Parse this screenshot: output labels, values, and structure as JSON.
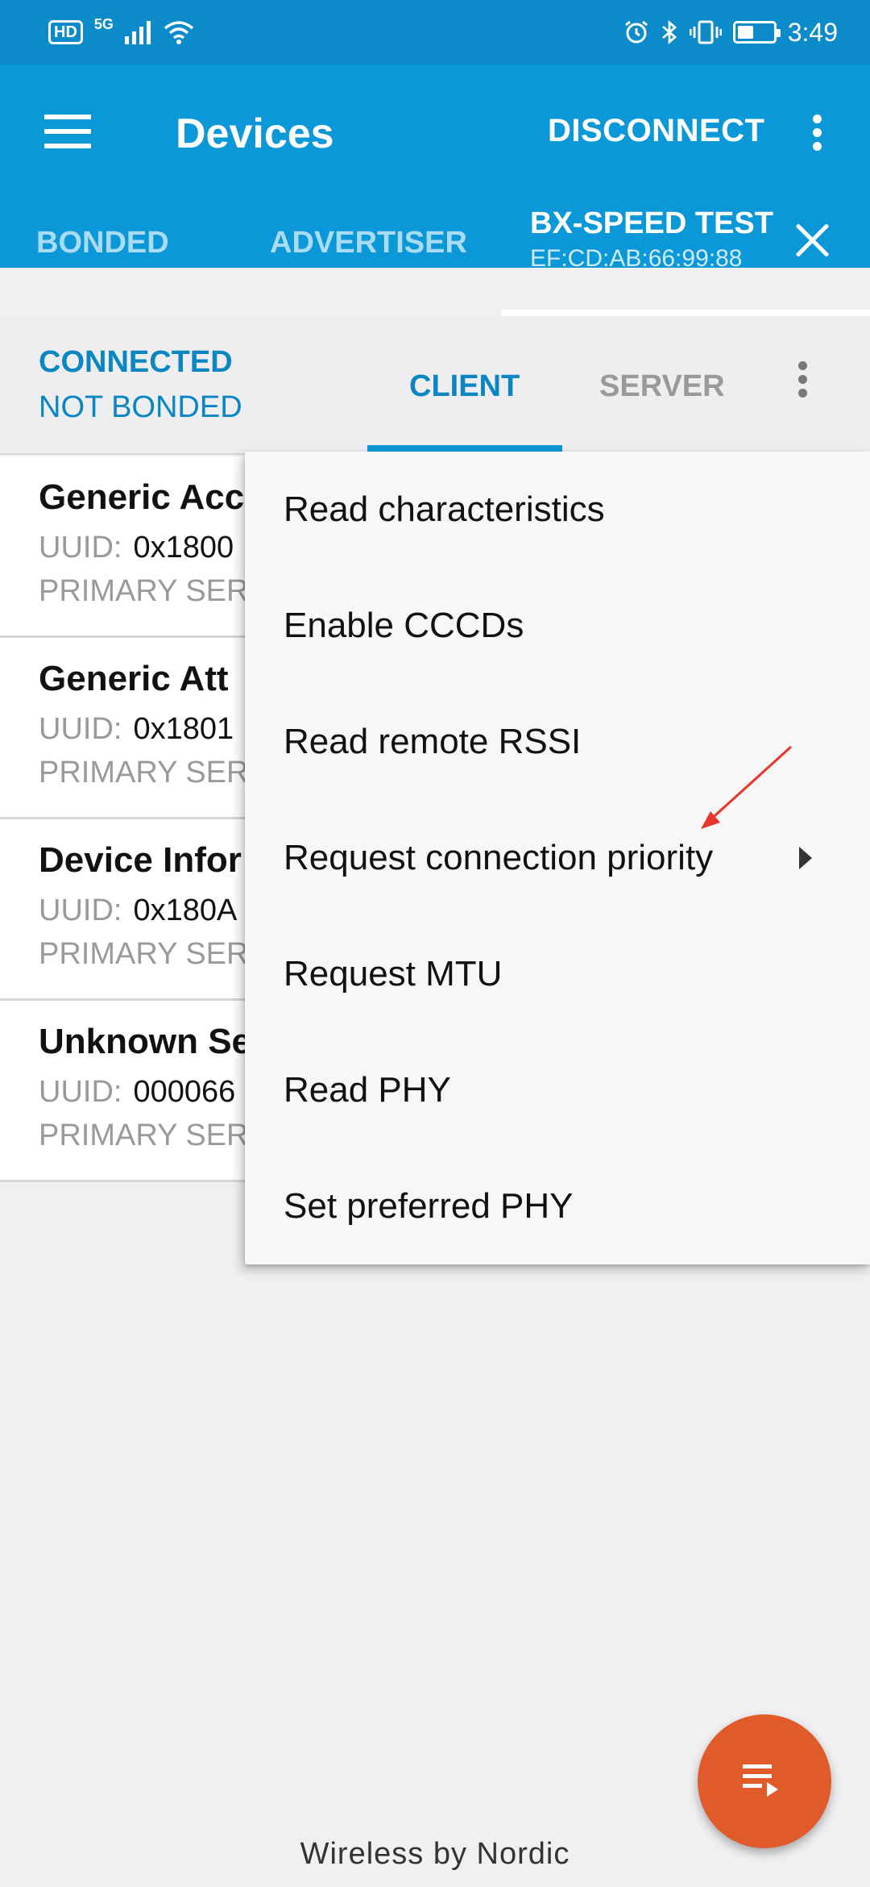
{
  "status_bar": {
    "hd": "HD",
    "network": "5G",
    "time": "3:49",
    "icons": [
      "hd-icon",
      "signal-icon",
      "wifi-icon",
      "alarm-icon",
      "bluetooth-icon",
      "vibrate-icon",
      "battery-icon"
    ],
    "battery_level_percent": 45
  },
  "toolbar": {
    "title": "Devices",
    "disconnect_label": "DISCONNECT"
  },
  "tabs": {
    "bonded": "BONDED",
    "advertiser": "ADVERTISER",
    "device_name": "BX-SPEED TEST",
    "device_address": "EF:CD:AB:66:99:88"
  },
  "connection": {
    "state": "CONNECTED",
    "bond_state": "NOT BONDED",
    "client_tab": "CLIENT",
    "server_tab": "SERVER"
  },
  "services": [
    {
      "name": "Generic Acc",
      "uuid_label": "UUID:",
      "uuid": "0x1800",
      "type": "PRIMARY SER"
    },
    {
      "name": "Generic Att",
      "uuid_label": "UUID:",
      "uuid": "0x1801",
      "type": "PRIMARY SER"
    },
    {
      "name": "Device Infor",
      "uuid_label": "UUID:",
      "uuid": "0x180A",
      "type": "PRIMARY SER"
    },
    {
      "name": "Unknown Se",
      "uuid_label": "UUID:",
      "uuid": "000066",
      "type": "PRIMARY SER"
    }
  ],
  "popup_menu": {
    "items": [
      "Read characteristics",
      "Enable CCCDs",
      "Read remote RSSI",
      "Request connection priority",
      "Request MTU",
      "Read PHY",
      "Set preferred PHY"
    ]
  },
  "annotation": {
    "color": "#e8362c"
  },
  "fab": {
    "icon": "log-list-icon",
    "color": "#e05a2a"
  },
  "footer": "Wireless by Nordic",
  "colors": {
    "primary": "#0b98d8",
    "status_bar": "#0b8bc9",
    "accent": "#0a86c2"
  }
}
